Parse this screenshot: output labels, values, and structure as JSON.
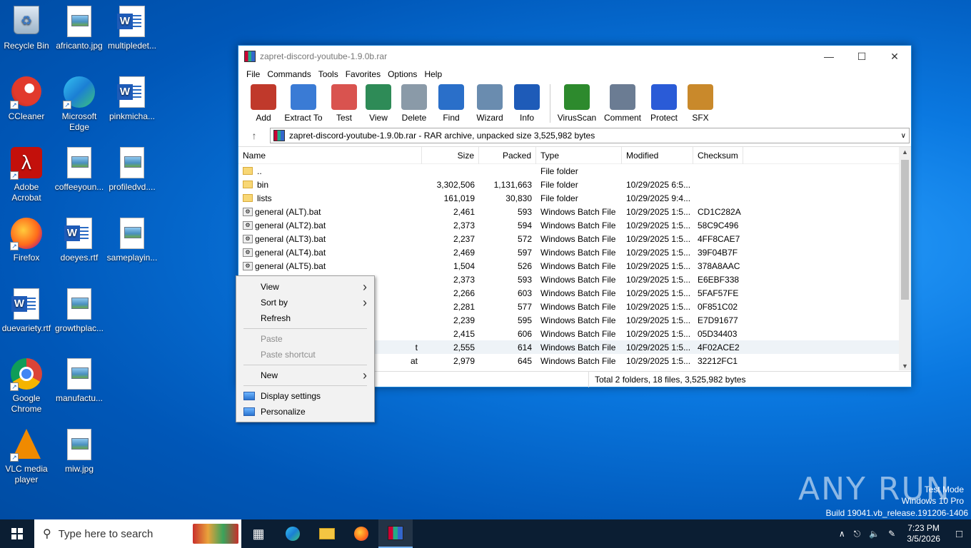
{
  "desktop": {
    "icons": [
      {
        "label": "Recycle Bin",
        "icon": "recycle-bin-icon"
      },
      {
        "label": "africanto.jpg",
        "icon": "image-file-icon"
      },
      {
        "label": "multipledet...",
        "icon": "word-doc-icon"
      },
      {
        "label": "CCleaner",
        "icon": "ccleaner-icon"
      },
      {
        "label": "Microsoft Edge",
        "icon": "edge-icon"
      },
      {
        "label": "pinkmicha...",
        "icon": "word-doc-icon"
      },
      {
        "label": "Adobe Acrobat",
        "icon": "acrobat-icon"
      },
      {
        "label": "coffeeyoun...",
        "icon": "image-file-icon"
      },
      {
        "label": "profiledvd....",
        "icon": "image-file-icon"
      },
      {
        "label": "Firefox",
        "icon": "firefox-icon"
      },
      {
        "label": "doeyes.rtf",
        "icon": "word-doc-icon"
      },
      {
        "label": "sameplayin...",
        "icon": "image-file-icon"
      },
      {
        "label": "duevariety.rtf",
        "icon": "word-doc-icon"
      },
      {
        "label": "growthplac...",
        "icon": "image-file-icon"
      },
      {
        "label": "Google Chrome",
        "icon": "chrome-icon"
      },
      {
        "label": "manufactu...",
        "icon": "image-file-icon"
      },
      {
        "label": "VLC media player",
        "icon": "vlc-icon"
      },
      {
        "label": "miw.jpg",
        "icon": "image-file-icon"
      }
    ]
  },
  "window": {
    "title": "zapret-discord-youtube-1.9.0b.rar",
    "menu": [
      "File",
      "Commands",
      "Tools",
      "Favorites",
      "Options",
      "Help"
    ],
    "toolbar": [
      {
        "label": "Add",
        "icon": "add-icon",
        "color": "#c0392b"
      },
      {
        "label": "Extract To",
        "icon": "extract-folder-icon",
        "color": "#3a7bd5"
      },
      {
        "label": "Test",
        "icon": "test-icon",
        "color": "#d9534f"
      },
      {
        "label": "View",
        "icon": "book-icon",
        "color": "#2e8b57"
      },
      {
        "label": "Delete",
        "icon": "trash-icon",
        "color": "#8a9aa8"
      },
      {
        "label": "Find",
        "icon": "magnifier-icon",
        "color": "#2a6fc9"
      },
      {
        "label": "Wizard",
        "icon": "wand-icon",
        "color": "#6a8caf"
      },
      {
        "label": "Info",
        "icon": "info-icon",
        "color": "#1e5bb8"
      },
      {
        "label": "VirusScan",
        "icon": "virus-icon",
        "color": "#2d8a2d"
      },
      {
        "label": "Comment",
        "icon": "comment-icon",
        "color": "#6b7c93"
      },
      {
        "label": "Protect",
        "icon": "shield-icon",
        "color": "#2a5bd7"
      },
      {
        "label": "SFX",
        "icon": "sfx-box-icon",
        "color": "#c9892b"
      }
    ],
    "address": "zapret-discord-youtube-1.9.0b.rar - RAR archive, unpacked size 3,525,982 bytes",
    "columns": {
      "name": "Name",
      "size": "Size",
      "packed": "Packed",
      "type": "Type",
      "modified": "Modified",
      "checksum": "Checksum"
    },
    "rows": [
      {
        "name": "..",
        "size": "",
        "packed": "",
        "type": "File folder",
        "modified": "",
        "crc": "",
        "kind": "folder"
      },
      {
        "name": "bin",
        "size": "3,302,506",
        "packed": "1,131,663",
        "type": "File folder",
        "modified": "10/29/2025 6:5...",
        "crc": "",
        "kind": "folder"
      },
      {
        "name": "lists",
        "size": "161,019",
        "packed": "30,830",
        "type": "File folder",
        "modified": "10/29/2025 9:4...",
        "crc": "",
        "kind": "folder"
      },
      {
        "name": "general (ALT).bat",
        "size": "2,461",
        "packed": "593",
        "type": "Windows Batch File",
        "modified": "10/29/2025 1:5...",
        "crc": "CD1C282A",
        "kind": "bat"
      },
      {
        "name": "general (ALT2).bat",
        "size": "2,373",
        "packed": "594",
        "type": "Windows Batch File",
        "modified": "10/29/2025 1:5...",
        "crc": "58C9C496",
        "kind": "bat"
      },
      {
        "name": "general (ALT3).bat",
        "size": "2,237",
        "packed": "572",
        "type": "Windows Batch File",
        "modified": "10/29/2025 1:5...",
        "crc": "4FF8CAE7",
        "kind": "bat"
      },
      {
        "name": "general (ALT4).bat",
        "size": "2,469",
        "packed": "597",
        "type": "Windows Batch File",
        "modified": "10/29/2025 1:5...",
        "crc": "39F04B7F",
        "kind": "bat"
      },
      {
        "name": "general (ALT5).bat",
        "size": "1,504",
        "packed": "526",
        "type": "Windows Batch File",
        "modified": "10/29/2025 1:5...",
        "crc": "378A8AAC",
        "kind": "bat"
      },
      {
        "name": "",
        "size": "2,373",
        "packed": "593",
        "type": "Windows Batch File",
        "modified": "10/29/2025 1:5...",
        "crc": "E6EBF338",
        "kind": "bat"
      },
      {
        "name": "",
        "size": "2,266",
        "packed": "603",
        "type": "Windows Batch File",
        "modified": "10/29/2025 1:5...",
        "crc": "5FAF57FE",
        "kind": "bat"
      },
      {
        "name": "",
        "size": "2,281",
        "packed": "577",
        "type": "Windows Batch File",
        "modified": "10/29/2025 1:5...",
        "crc": "0F851C02",
        "kind": "bat"
      },
      {
        "name": "",
        "size": "2,239",
        "packed": "595",
        "type": "Windows Batch File",
        "modified": "10/29/2025 1:5...",
        "crc": "E7D91677",
        "kind": "bat"
      },
      {
        "name": "",
        "size": "2,415",
        "packed": "606",
        "type": "Windows Batch File",
        "modified": "10/29/2025 1:5...",
        "crc": "05D34403",
        "kind": "bat"
      },
      {
        "name": "t",
        "size": "2,555",
        "packed": "614",
        "type": "Windows Batch File",
        "modified": "10/29/2025 1:5...",
        "crc": "4F02ACE2",
        "kind": "bat"
      },
      {
        "name": "at",
        "size": "2,979",
        "packed": "645",
        "type": "Windows Batch File",
        "modified": "10/29/2025 1:5...",
        "crc": "32212FC1",
        "kind": "bat"
      }
    ],
    "status": "Total 2 folders, 18 files, 3,525,982 bytes"
  },
  "context_menu": {
    "items": [
      {
        "label": "View",
        "submenu": true,
        "disabled": false
      },
      {
        "label": "Sort by",
        "submenu": true,
        "disabled": false
      },
      {
        "label": "Refresh",
        "submenu": false,
        "disabled": false
      },
      {
        "sep": true
      },
      {
        "label": "Paste",
        "submenu": false,
        "disabled": true
      },
      {
        "label": "Paste shortcut",
        "submenu": false,
        "disabled": true
      },
      {
        "sep": true
      },
      {
        "label": "New",
        "submenu": true,
        "disabled": false
      },
      {
        "sep": true
      },
      {
        "label": "Display settings",
        "submenu": false,
        "disabled": false,
        "icon": "display-icon"
      },
      {
        "label": "Personalize",
        "submenu": false,
        "disabled": false,
        "icon": "personalize-icon"
      }
    ]
  },
  "watermark": {
    "brand": "ANY RUN",
    "line1": "Test Mode",
    "line2": "Windows 10 Pro",
    "line3": "Build 19041.vb_release.191206-1406"
  },
  "taskbar": {
    "search_placeholder": "Type here to search",
    "apps": [
      "task-view-icon",
      "edge-icon",
      "file-explorer-icon",
      "firefox-icon",
      "winrar-icon"
    ],
    "time": "7:23 PM",
    "date": "3/5/2026"
  }
}
